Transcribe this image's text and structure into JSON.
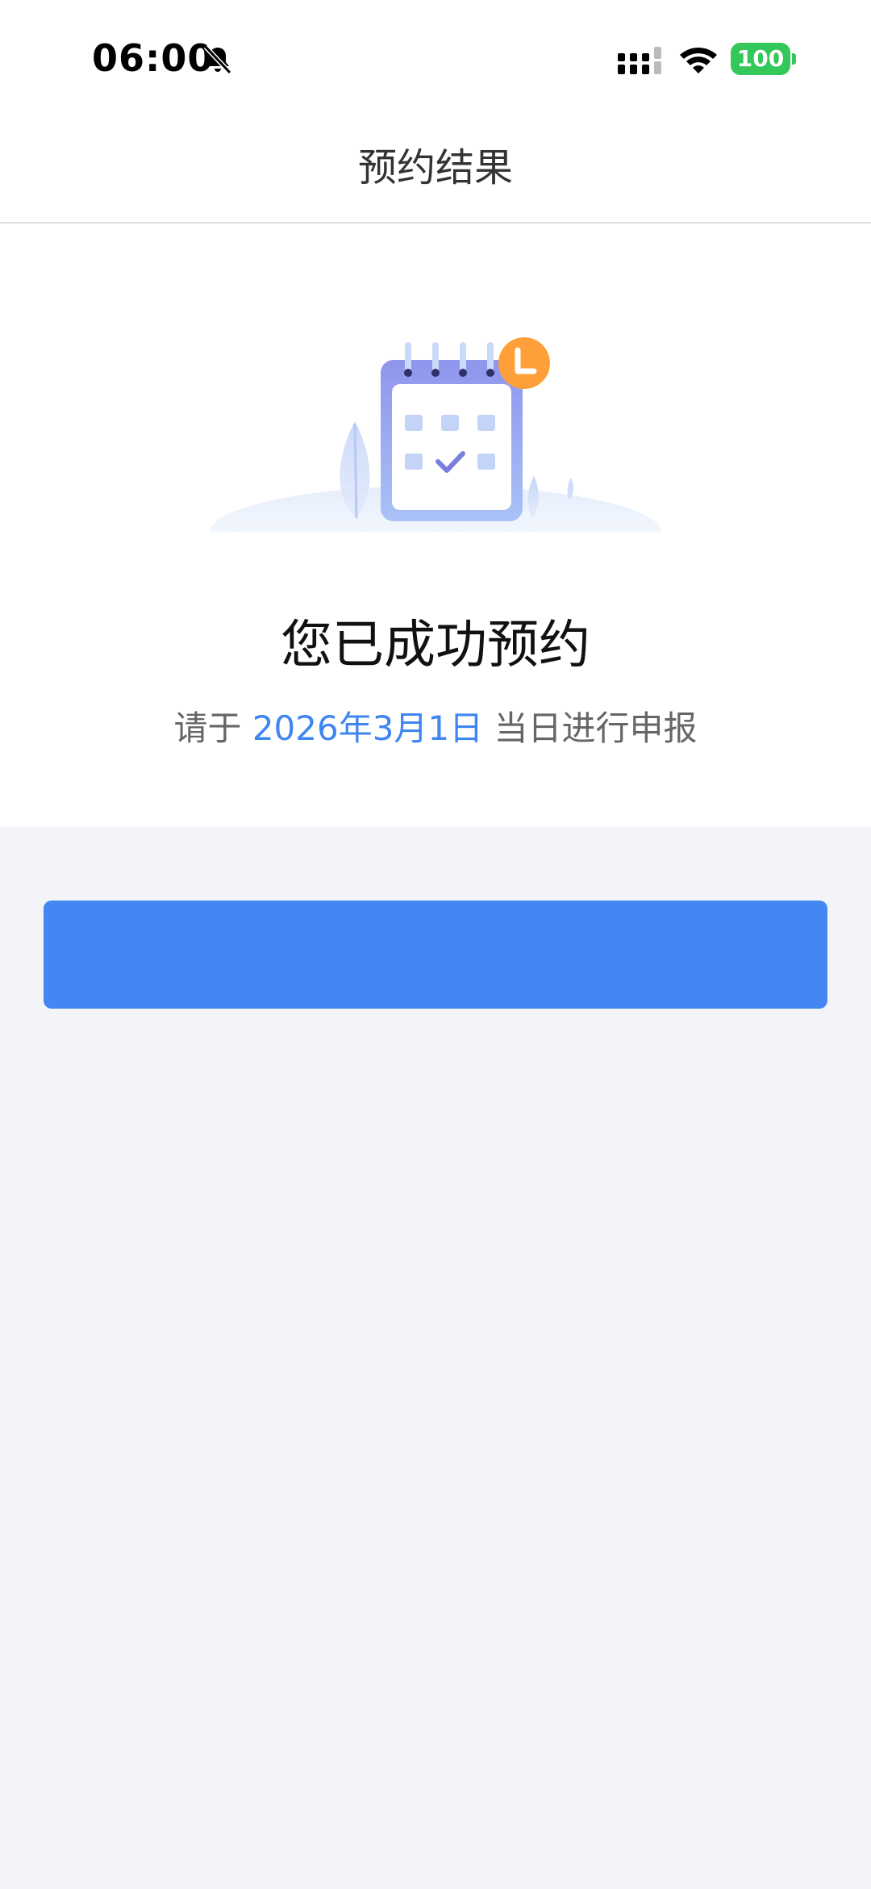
{
  "status_bar": {
    "time": "06:00",
    "battery": "100",
    "icons": [
      "bell-muted-icon",
      "signal-icon",
      "wifi-icon",
      "battery-icon"
    ]
  },
  "nav": {
    "title": "预约结果"
  },
  "result": {
    "illustration": "calendar-check-icon",
    "title": "您已成功预约",
    "sub_prefix": "请于 ",
    "date": "2026年3月1日",
    "sub_suffix": " 当日进行申报"
  },
  "button": {
    "label": "",
    "color": "#4587f2"
  },
  "colors": {
    "accent": "#3f86f0",
    "page_bg": "#f2f4f8",
    "battery": "#34c759",
    "badge": "#ff9f3a"
  }
}
